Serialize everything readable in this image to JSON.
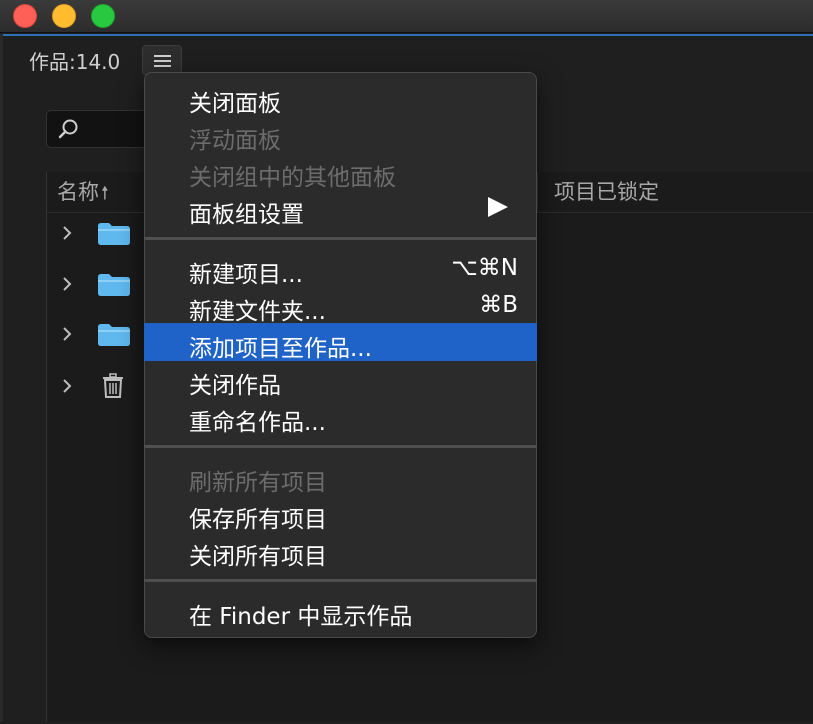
{
  "panel": {
    "title": "作品:14.0",
    "column_name": "名称",
    "column_sort_icon": "arrow-up-icon",
    "column_locked": "项目已锁定",
    "search_icon": "search-icon",
    "rows": [
      {
        "type": "folder"
      },
      {
        "type": "folder"
      },
      {
        "type": "folder"
      },
      {
        "type": "trash"
      }
    ]
  },
  "menu": {
    "items": [
      {
        "label": "关闭面板",
        "enabled": true
      },
      {
        "label": "浮动面板",
        "enabled": false
      },
      {
        "label": "关闭组中的其他面板",
        "enabled": false
      },
      {
        "label": "面板组设置",
        "enabled": true,
        "submenu": true
      },
      {
        "label": "新建项目...",
        "shortcut": "⌥⌘N",
        "enabled": true
      },
      {
        "label": "新建文件夹...",
        "shortcut": "⌘B",
        "enabled": true
      },
      {
        "label": "添加项目至作品...",
        "enabled": true,
        "highlighted": true
      },
      {
        "label": "关闭作品",
        "enabled": true
      },
      {
        "label": "重命名作品...",
        "enabled": true
      },
      {
        "label": "刷新所有项目",
        "enabled": false
      },
      {
        "label": "保存所有项目",
        "enabled": true
      },
      {
        "label": "关闭所有项目",
        "enabled": true
      },
      {
        "label": "在 Finder 中显示作品",
        "enabled": true
      }
    ]
  },
  "colors": {
    "highlight": "#1f63c9",
    "accent_border": "#2c6fb3",
    "folder": "#5fb8ee"
  }
}
